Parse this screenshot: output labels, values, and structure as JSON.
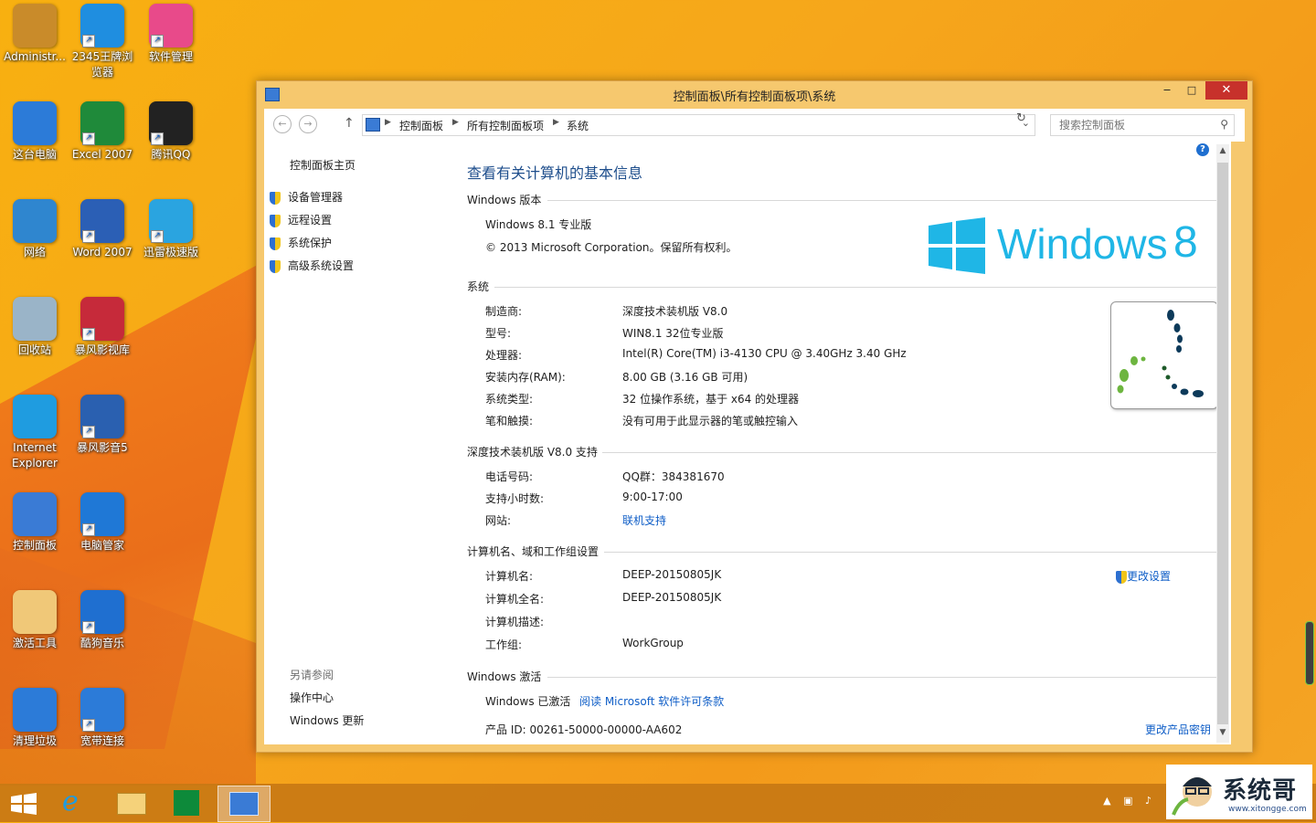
{
  "desktop": {
    "icons": [
      {
        "label": "Administr..."
      },
      {
        "label": "2345王牌浏览器"
      },
      {
        "label": "软件管理"
      },
      {
        "label": "这台电脑"
      },
      {
        "label": "Excel 2007"
      },
      {
        "label": "腾讯QQ"
      },
      {
        "label": "网络"
      },
      {
        "label": "Word 2007"
      },
      {
        "label": "迅雷极速版"
      },
      {
        "label": "回收站"
      },
      {
        "label": "暴风影视库"
      },
      {
        "label": "Internet Explorer"
      },
      {
        "label": "暴风影音5"
      },
      {
        "label": "控制面板"
      },
      {
        "label": "电脑管家"
      },
      {
        "label": "激活工具"
      },
      {
        "label": "酷狗音乐"
      },
      {
        "label": "清理垃圾"
      },
      {
        "label": "宽带连接"
      }
    ]
  },
  "window": {
    "title": "控制面板\\所有控制面板项\\系统",
    "controls": {
      "minimize": "‒",
      "maximize": "□",
      "close": "✕"
    },
    "address": {
      "crumbs": [
        "控制面板",
        "所有控制面板项",
        "系统"
      ]
    },
    "search": {
      "placeholder": "搜索控制面板"
    }
  },
  "leftnav": {
    "home": "控制面板主页",
    "items": [
      "设备管理器",
      "远程设置",
      "系统保护",
      "高级系统设置"
    ],
    "see_also_title": "另请参阅",
    "see_also": [
      "操作中心",
      "Windows 更新"
    ]
  },
  "main": {
    "title": "查看有关计算机的基本信息",
    "edition": {
      "heading": "Windows 版本",
      "name": "Windows 8.1 专业版",
      "copyright": "© 2013 Microsoft Corporation。保留所有权利。",
      "logo_text": "Windows",
      "logo_num": "8"
    },
    "system": {
      "heading": "系统",
      "rows": [
        {
          "label": "制造商:",
          "value": "深度技术装机版 V8.0"
        },
        {
          "label": "型号:",
          "value": "WIN8.1 32位专业版"
        },
        {
          "label": "处理器:",
          "value": "Intel(R) Core(TM) i3-4130 CPU @ 3.40GHz   3.40 GHz"
        },
        {
          "label": "安装内存(RAM):",
          "value": "8.00 GB (3.16 GB 可用)"
        },
        {
          "label": "系统类型:",
          "value": "32 位操作系统，基于 x64 的处理器"
        },
        {
          "label": "笔和触摸:",
          "value": "没有可用于此显示器的笔或触控输入"
        }
      ]
    },
    "support": {
      "heading": "深度技术装机版 V8.0 支持",
      "rows": [
        {
          "label": "电话号码:",
          "value": "QQ群：384381670"
        },
        {
          "label": "支持小时数:",
          "value": "9:00-17:00"
        },
        {
          "label": "网站:",
          "value": "联机支持"
        }
      ]
    },
    "computer": {
      "heading": "计算机名、域和工作组设置",
      "change_link": "更改设置",
      "rows": [
        {
          "label": "计算机名:",
          "value": "DEEP-20150805JK"
        },
        {
          "label": "计算机全名:",
          "value": "DEEP-20150805JK"
        },
        {
          "label": "计算机描述:",
          "value": ""
        },
        {
          "label": "工作组:",
          "value": "WorkGroup"
        }
      ]
    },
    "activation": {
      "heading": "Windows 激活",
      "status": "Windows 已激活",
      "license_link": "阅读 Microsoft 软件许可条款",
      "product_id": "产品 ID: 00261-50000-00000-AA602",
      "change_key": "更改产品密钥"
    }
  },
  "watermark": {
    "title": "系统哥",
    "url": "www.xitongge.com"
  },
  "colors": {
    "accent_link": "#0f5ec7",
    "title_blue": "#1e4e8c",
    "win8_cyan": "#1fb6e6",
    "close_red": "#c7312b"
  }
}
